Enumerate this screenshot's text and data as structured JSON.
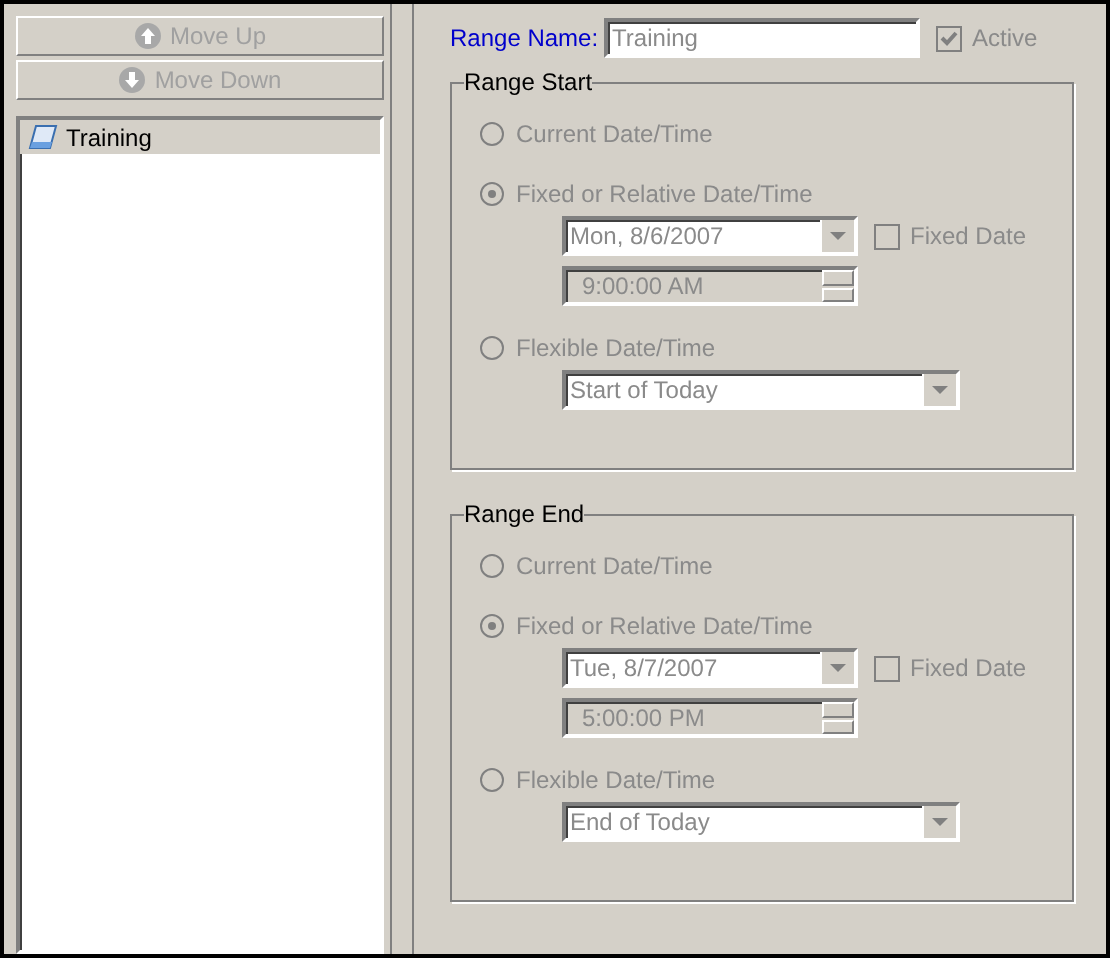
{
  "toolbar": {
    "buttons": [
      {
        "label": "Move Up",
        "kind": "up",
        "disabled": true
      },
      {
        "label": "Move Down",
        "kind": "down",
        "disabled": true
      }
    ]
  },
  "list": {
    "items": [
      {
        "label": "Training",
        "selected": true
      }
    ]
  },
  "form": {
    "disabled": true,
    "range_name_label": "Range Name:",
    "range_name": "Training",
    "active_label": "Active",
    "active": true,
    "groups": [
      {
        "title": "Range Start",
        "options": [
          {
            "label": "Current Date/Time",
            "selected": false,
            "kind": "plain"
          },
          {
            "label": "Fixed or Relative Date/Time",
            "selected": true,
            "kind": "fixed"
          },
          {
            "label": "Flexible Date/Time",
            "selected": false,
            "kind": "flexible"
          }
        ],
        "date": "Mon, 8/6/2007",
        "fixed_date_label": "Fixed Date",
        "fixed_date": false,
        "time": "9:00:00 AM",
        "flexible": "Start of Today"
      },
      {
        "title": "Range End",
        "options": [
          {
            "label": "Current Date/Time",
            "selected": false,
            "kind": "plain"
          },
          {
            "label": "Fixed or Relative Date/Time",
            "selected": true,
            "kind": "fixed"
          },
          {
            "label": "Flexible Date/Time",
            "selected": false,
            "kind": "flexible"
          }
        ],
        "date": "Tue, 8/7/2007",
        "fixed_date_label": "Fixed Date",
        "fixed_date": false,
        "time": "5:00:00 PM",
        "flexible": "End of Today"
      }
    ]
  }
}
